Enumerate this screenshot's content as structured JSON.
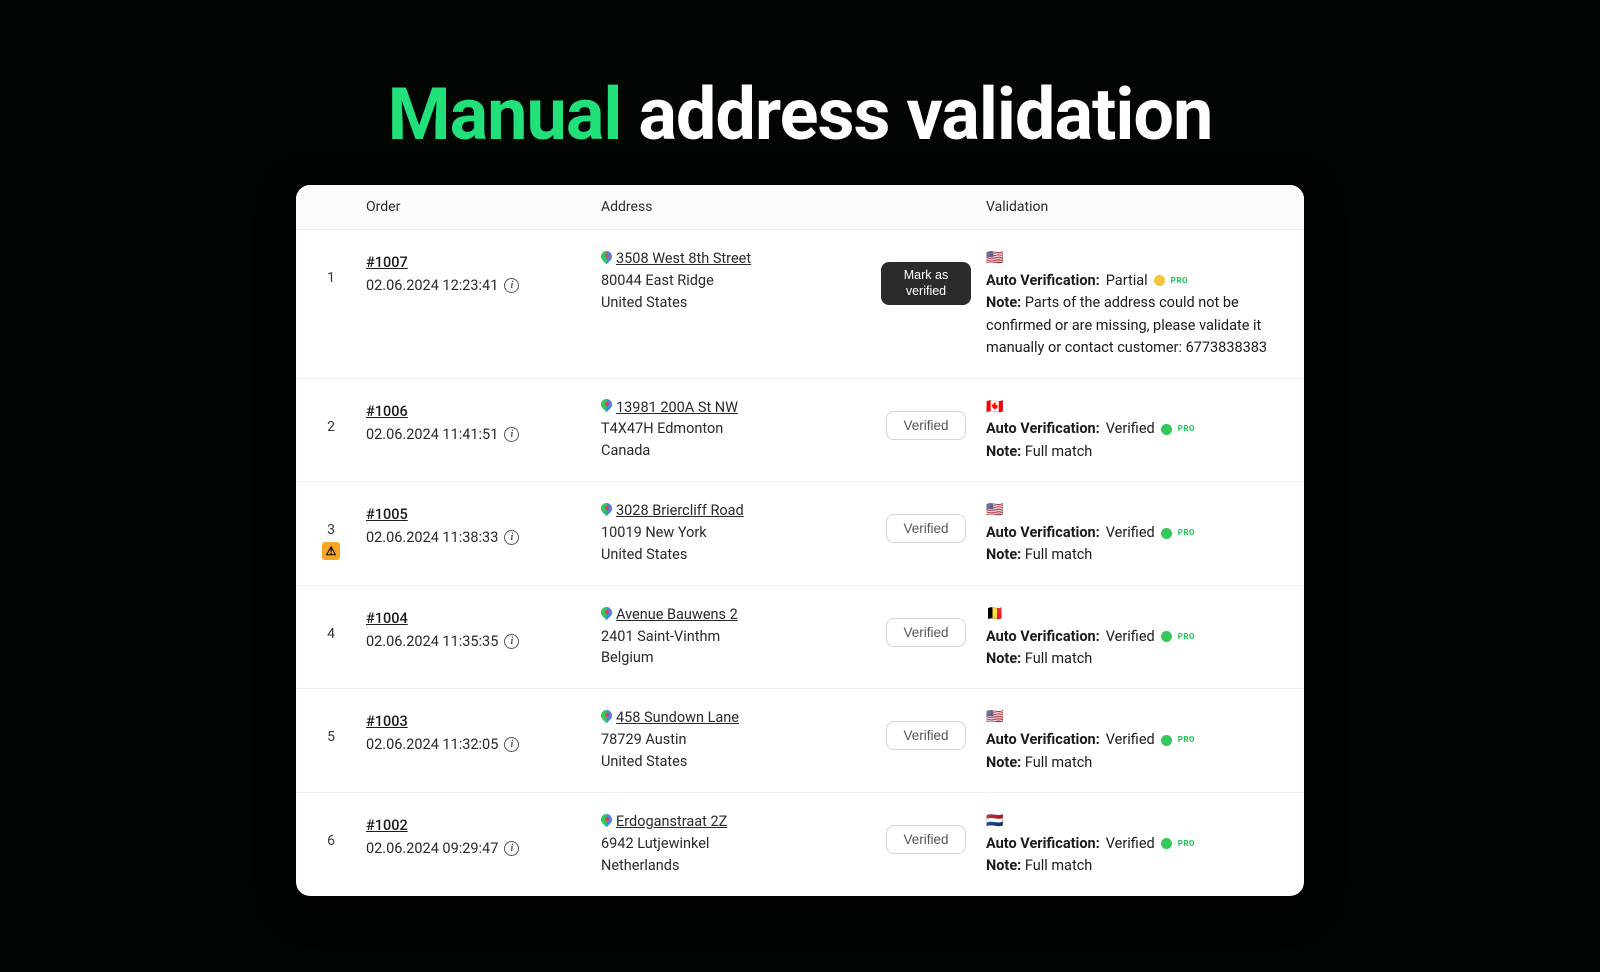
{
  "title_accent": "Manual",
  "title_rest": "address validation",
  "columns": {
    "order": "Order",
    "address": "Address",
    "validation": "Validation"
  },
  "labels": {
    "auto_verification": "Auto Verification:",
    "note": "Note:",
    "pro": "PRO"
  },
  "buttons": {
    "mark_as_verified": "Mark as verified",
    "verified": "Verified"
  },
  "rows": [
    {
      "idx": "1",
      "warn": false,
      "order_num": "#1007",
      "timestamp": "02.06.2024 12:23:41",
      "addr_link": "3508 West 8th Street",
      "addr_line2": "80044 East Ridge",
      "addr_country": "United States",
      "action": "mark",
      "flag": "🇺🇸",
      "av_status": "Partial",
      "av_dot": "yellow",
      "note": "Parts of the address could not be confirmed or are missing, please validate it manually or contact customer: 6773838383"
    },
    {
      "idx": "2",
      "warn": false,
      "order_num": "#1006",
      "timestamp": "02.06.2024 11:41:51",
      "addr_link": "13981 200A St NW",
      "addr_line2": "T4X47H Edmonton",
      "addr_country": "Canada",
      "action": "verified",
      "flag": "🇨🇦",
      "av_status": "Verified",
      "av_dot": "green",
      "note": "Full match"
    },
    {
      "idx": "3",
      "warn": true,
      "order_num": "#1005",
      "timestamp": "02.06.2024 11:38:33",
      "addr_link": "3028 Briercliff Road",
      "addr_line2": "10019 New York",
      "addr_country": "United States",
      "action": "verified",
      "flag": "🇺🇸",
      "av_status": "Verified",
      "av_dot": "green",
      "note": "Full match"
    },
    {
      "idx": "4",
      "warn": false,
      "order_num": "#1004",
      "timestamp": "02.06.2024 11:35:35",
      "addr_link": "Avenue Bauwens 2",
      "addr_line2": "2401 Saint-Vinthm",
      "addr_country": "Belgium",
      "action": "verified",
      "flag": "🇧🇪",
      "av_status": "Verified",
      "av_dot": "green",
      "note": "Full match"
    },
    {
      "idx": "5",
      "warn": false,
      "order_num": "#1003",
      "timestamp": "02.06.2024 11:32:05",
      "addr_link": "458 Sundown Lane",
      "addr_line2": "78729 Austin",
      "addr_country": "United States",
      "action": "verified",
      "flag": "🇺🇸",
      "av_status": "Verified",
      "av_dot": "green",
      "note": "Full match"
    },
    {
      "idx": "6",
      "warn": false,
      "order_num": "#1002",
      "timestamp": "02.06.2024 09:29:47",
      "addr_link": "Erdoganstraat 2Z",
      "addr_line2": "6942 Lutjewinkel",
      "addr_country": "Netherlands",
      "action": "verified",
      "flag": "🇳🇱",
      "av_status": "Verified",
      "av_dot": "green",
      "note": "Full match"
    }
  ]
}
